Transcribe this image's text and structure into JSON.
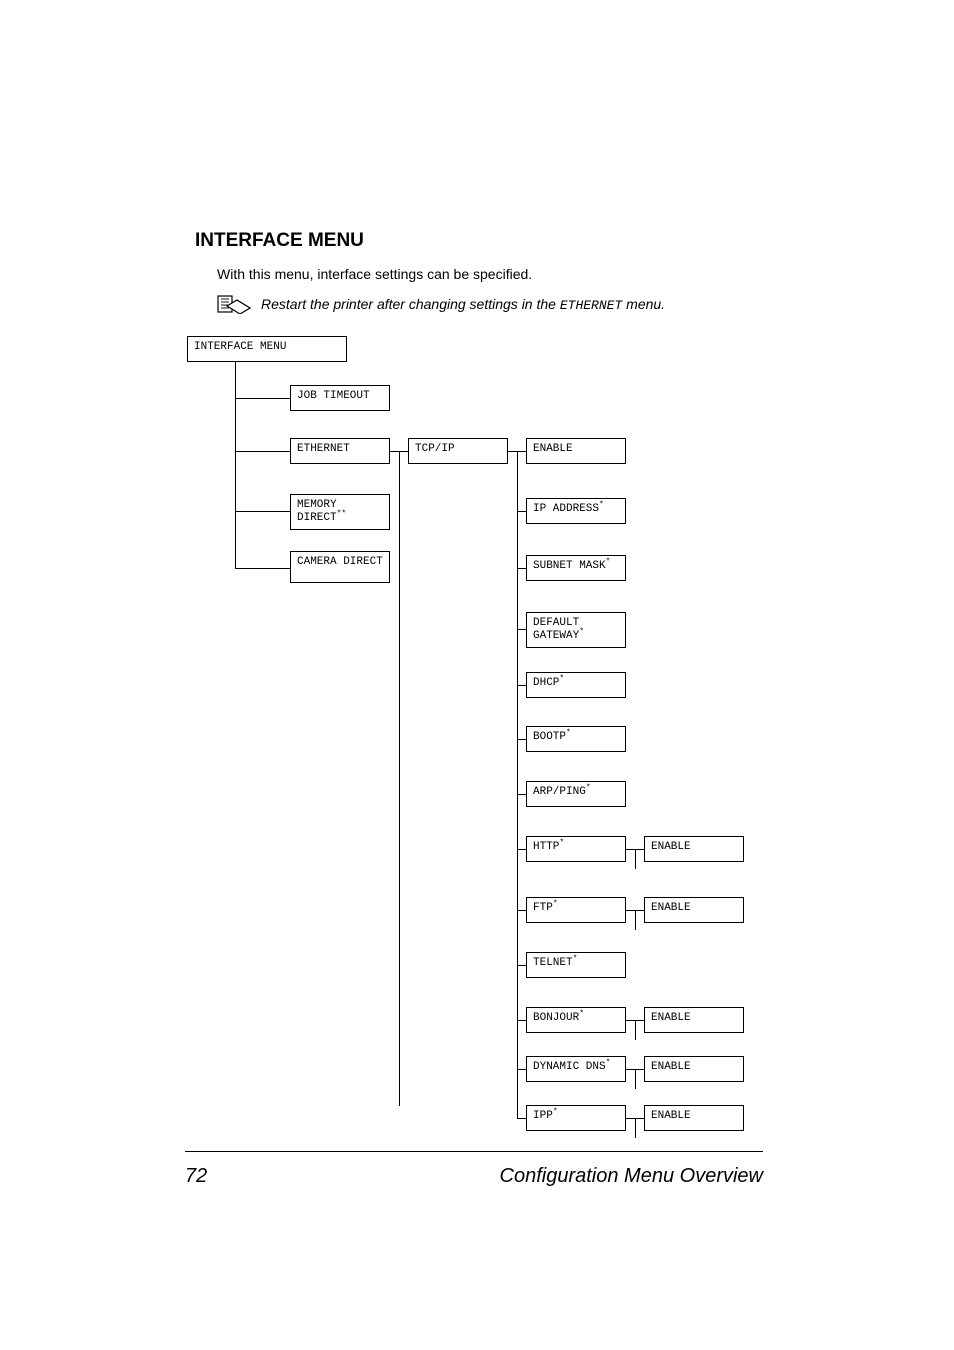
{
  "heading": "INTERFACE MENU",
  "body_text": "With this menu, interface settings can be specified.",
  "note": {
    "prefix": "Restart the printer after changing settings in the ",
    "mono": "ETHERNET",
    "suffix": " menu."
  },
  "labels": {
    "interface_menu": "INTERFACE MENU",
    "job_timeout": "JOB TIMEOUT",
    "ethernet": "ETHERNET",
    "memory_direct": "MEMORY DIRECT",
    "memory_direct_sup": "**",
    "camera_direct": "CAMERA DIRECT",
    "tcpip": "TCP/IP",
    "enable": "ENABLE",
    "ip_address": "IP ADDRESS",
    "subnet_mask": "SUBNET MASK",
    "default_gateway_l1": "DEFAULT",
    "default_gateway_l2": "GATEWAY",
    "dhcp": "DHCP",
    "bootp": "BOOTP",
    "arpping": "ARP/PING",
    "http": "HTTP",
    "ftp": "FTP",
    "telnet": "TELNET",
    "bonjour": "BONJOUR",
    "dynamic_dns": "DYNAMIC DNS",
    "ipp": "IPP",
    "star": "*"
  },
  "footer": {
    "page": "72",
    "title": "Configuration Menu Overview"
  }
}
